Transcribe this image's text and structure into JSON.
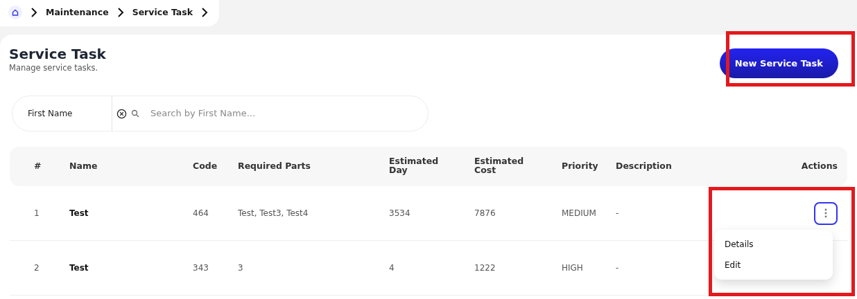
{
  "breadcrumb": {
    "items": [
      "Maintenance",
      "Service Task"
    ]
  },
  "header": {
    "title": "Service Task",
    "subtitle": "Manage service tasks.",
    "button": {
      "label": "New Service Task",
      "highlighted": true
    }
  },
  "filter": {
    "label": "First Name",
    "placeholder": "Search by First Name..."
  },
  "table": {
    "columns": [
      "#",
      "Name",
      "Code",
      "Required Parts",
      "Estimated Day",
      "Estimated Cost",
      "Priority",
      "Description",
      "Actions"
    ],
    "rows": [
      {
        "cells": [
          "1",
          "Test",
          "464",
          "Test, Test3, Test4",
          "3534",
          "7876",
          "MEDIUM",
          "-"
        ],
        "menu_open": true
      },
      {
        "cells": [
          "2",
          "Test",
          "343",
          "3",
          "4",
          "1222",
          "HIGH",
          "-"
        ],
        "menu_open": false
      }
    ]
  },
  "actions_menu": {
    "items": [
      "Details",
      "Edit"
    ],
    "highlighted": true
  }
}
